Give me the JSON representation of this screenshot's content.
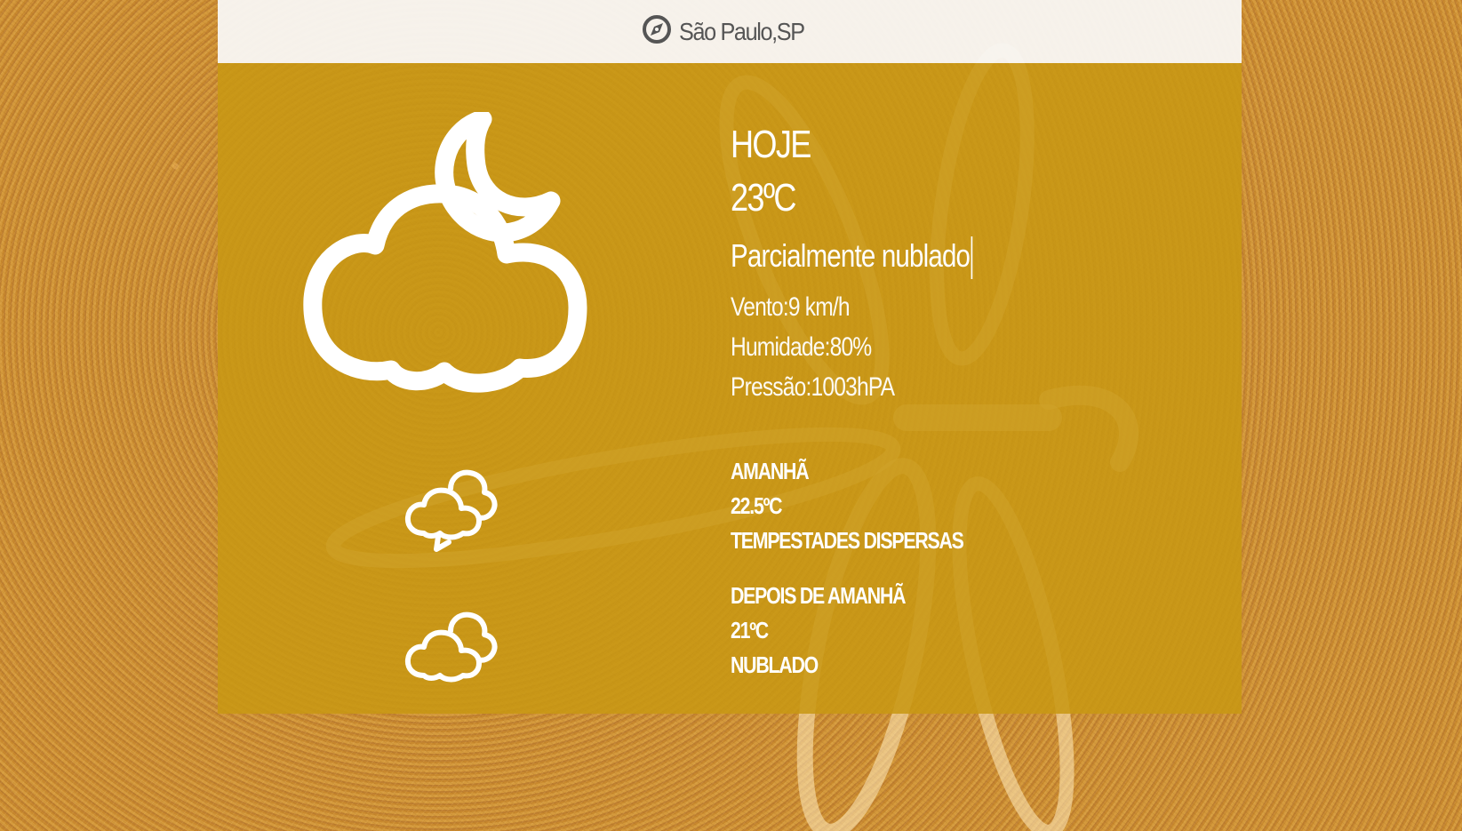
{
  "header": {
    "location": "São Paulo,SP",
    "icon": "compass-icon"
  },
  "today": {
    "day": "HOJE",
    "temperature": "23ºC",
    "condition": "Parcialmente nublado",
    "icon": "cloud-moon-icon",
    "wind": "Vento:9 km/h",
    "humidity": "Humidade:80%",
    "pressure": "Pressão:1003hPA"
  },
  "forecast": [
    {
      "day": "AMANHÃ",
      "temperature": "22.5ºC",
      "condition": "TEMPESTADES DISPERSAS",
      "icon": "thunderstorm-cloud-icon"
    },
    {
      "day": "DEPOIS DE AMANHÃ",
      "temperature": "21ºC",
      "condition": "NUBLADO",
      "icon": "clouds-icon"
    }
  ],
  "colors": {
    "panel": "#c89814",
    "header_bg": "#f8f6f2",
    "header_text": "#555555",
    "text": "#ffffff"
  }
}
